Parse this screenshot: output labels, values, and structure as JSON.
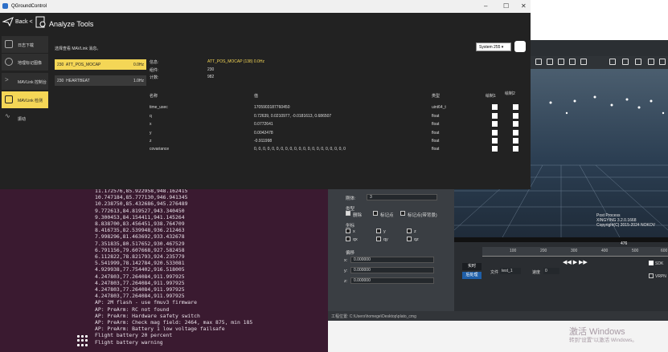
{
  "window": {
    "title": "QGroundControl",
    "back_label": "Back",
    "back_sep": "<",
    "page_title": "Analyze Tools",
    "controls": [
      "–",
      "☐",
      "✕"
    ]
  },
  "sidebar": {
    "items": [
      {
        "label": "日志下载",
        "icon": "list-icon"
      },
      {
        "label": "地理标记图像",
        "icon": "location-pin-icon"
      },
      {
        "label": "MAVLink 控制台",
        "icon": "chevron-right-icon"
      },
      {
        "label": "MAVLink 检测",
        "icon": "waveform-icon",
        "active": true
      },
      {
        "label": "振动",
        "icon": "vibration-icon"
      }
    ]
  },
  "inspector": {
    "hint": "选择查看 MAVLink 消息。",
    "system_select": "System 255",
    "messages": [
      {
        "id": "230",
        "name": "ATT_POS_MOCAP",
        "rate": "0.0Hz",
        "selected": true
      },
      {
        "id": "230",
        "name": "HEARTBEAT",
        "rate": "1.0Hz",
        "selected": false
      }
    ],
    "info": [
      {
        "label": "信息:",
        "value": "ATT_POS_MOCAP (138) 0.0Hz"
      },
      {
        "label": "组件:",
        "value": "230"
      },
      {
        "label": "计数:",
        "value": "982"
      }
    ],
    "columns": {
      "name": "名称",
      "value": "值",
      "type": "类型",
      "plot1": "绘制1",
      "plot2": "绘制2"
    },
    "fields": [
      {
        "name": "time_usec",
        "value": "1705903187760450",
        "type": "uint64_t"
      },
      {
        "name": "q",
        "value": "0.72639, 0.0210977, -0.0181613, 0.686507",
        "type": "float"
      },
      {
        "name": "x",
        "value": "0.0772641",
        "type": "float"
      },
      {
        "name": "y",
        "value": "0.0042478",
        "type": "float"
      },
      {
        "name": "z",
        "value": "-0.911998",
        "type": "float"
      },
      {
        "name": "covariance",
        "value": "0, 0, 0, 0, 0, 0, 0, 0, 0, 0, 0, 0, 0, 0, 0, 0, 0, 0, 0, 0, 0",
        "type": "float"
      }
    ]
  },
  "terminal": {
    "lines": [
      "11.172576,85.922958,948.162415",
      "10.747184,85.777130,946.941345",
      "10.238750,85.432686,945.276489",
      "9.772613,84.819527,943.340450",
      "9.300453,84.154411,941.145264",
      "8.838700,83.456451,938.764709",
      "8.416735,82.539948,936.212463",
      "7.998296,81.463692,933.432678",
      "7.351835,80.517652,930.467529",
      "6.791156,79.607668,927.582458",
      "6.112822,78.821793,924.235779",
      "5.541999,78.142784,920.533081",
      "4.929938,77.754402,916.518005",
      "4.247803,77.264084,911.997925",
      "4.247803,77.264084,911.997925",
      "4.247803,77.264084,911.997925",
      "4.247803,77.264084,911.997925",
      "AP: 2M flash - use fmuv3 firmware",
      "AP: PreArm: RC not found",
      "AP: PreArm: Hardware safety switch",
      "AP: PreArm: Check mag field: 2464, max 875, min 185",
      "AP: PreArm: Battery 1 low voltage failsafe",
      "Flight battery 20 percent",
      "Flight battery warning"
    ]
  },
  "right_app": {
    "left_panel": {
      "rigid_label": "刚体:",
      "rigid_value": "3",
      "type_label": "类型",
      "type_options": [
        "删除",
        "标记点",
        "标记点(带背景)"
      ],
      "axis_label": "坐标",
      "axes": [
        "x",
        "y",
        "z",
        "qx",
        "qy",
        "qz"
      ],
      "offset_label": "偏移",
      "offsets": [
        {
          "axis": "x:",
          "value": "0.000000"
        },
        {
          "axis": "y:",
          "value": "0.000000"
        },
        {
          "axis": "z:",
          "value": "0.000000"
        }
      ]
    },
    "view_text": [
      "Post Process",
      "XINGYING 3.2.0.1668",
      "Copyright(C) 2015-2024 NOKOV"
    ],
    "ruler_ticks": [
      "100",
      "200",
      "300",
      "400",
      "500",
      "600"
    ],
    "ruler_marker": "476",
    "controls": {
      "realtime": "实时",
      "post": "后处理",
      "file_label": "文件",
      "file_value": "test_1",
      "speed_label": "速度",
      "speed_value": "0",
      "sdk": "SDK",
      "vrpn": "VRPN"
    },
    "status_path": "工程位置:   C:\\Users\\homege\\Desktop\\plato_cmg"
  },
  "watermark": {
    "title": "激活 Windows",
    "subtitle": "转到\"设置\"以激活 Windows。"
  },
  "colors": {
    "accent": "#f4d656",
    "terminal_bg": "#3a1a30",
    "window_bg": "#222222"
  }
}
